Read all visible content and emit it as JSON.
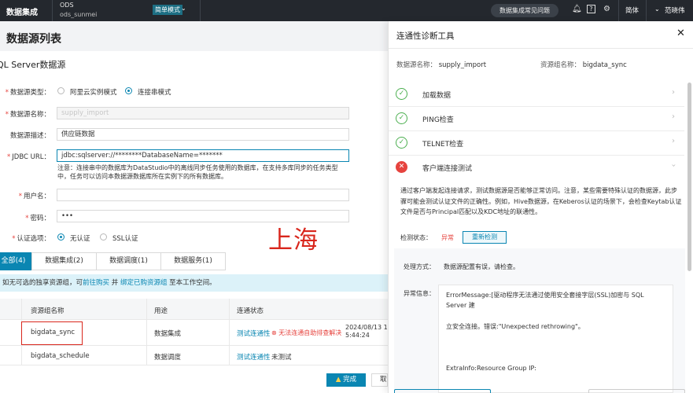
{
  "topbar": {
    "brand": "数据集成",
    "workspace_name": "ODS",
    "workspace_id": "ods_sunmei",
    "mode": "简单模式",
    "faq": "数据集成常见问题",
    "lang": "简体",
    "user": "范晓伟"
  },
  "page": {
    "title": "数据源列表",
    "section": "QL Server数据源"
  },
  "form": {
    "type_label": "数据源类型：",
    "type_opt1": "阿里云实例模式",
    "type_opt2": "连接串模式",
    "name_label": "数据源名称：",
    "name_value": "supply_import",
    "desc_label": "数据源描述：",
    "desc_value": "供应链数据",
    "jdbc_label": "JDBC URL：",
    "jdbc_value": "jdbc:sqlserver://********DatabaseName=*******",
    "note": "注意：连接串中的数据库为DataStudio中的离线同步任务使用的数据库，在支持多库同步的任务类型中，任务可以访问本数据源数据库所在实例下的所有数据库。",
    "user_label": "用户名：",
    "pwd_label": "密码：",
    "pwd_value": "•••",
    "auth_label": "认证选项：",
    "auth_opt1": "无认证",
    "auth_opt2": "SSL认证"
  },
  "overlay_text": "上海",
  "tabs": [
    "全部(4)",
    "数据集成(2)",
    "数据调度(1)",
    "数据服务(1)"
  ],
  "infobar": {
    "prefix": "如无可选的独享资源组，可",
    "link1": "前往购买",
    "mid": "并",
    "link2": "绑定已购资源组",
    "suffix": "至本工作空间。"
  },
  "table": {
    "headers": [
      "资源组名称",
      "用途",
      "连通状态"
    ],
    "rows": [
      {
        "name": "bigdata_sync",
        "use": "数据集成",
        "test": "测试连通性",
        "status": "⊗ 无法连通自助排查解决",
        "time": "2024/08/13 1\n5:44:24"
      },
      {
        "name": "bigdata_schedule",
        "use": "数据调度",
        "test": "测试连通性",
        "status": "未测试",
        "time": ""
      }
    ]
  },
  "buttons": {
    "done": "完成",
    "cut": "取"
  },
  "panel": {
    "title": "连通性诊断工具",
    "ds_label": "数据源名称：",
    "ds_value": "supply_import",
    "rg_label": "资源组名称：",
    "rg_value": "bigdata_sync",
    "checks": [
      "加载数据",
      "PING检查",
      "TELNET检查",
      "客户端连接测试"
    ],
    "desc": "通过客户端发起连接请求，测试数据源是否能够正常访问。注意，某些需要特殊认证的数据源，此步骤可能会测试认证文件的正确性。例如，Hive数据源，在Keberos认证的场景下，会检查Keytab认证文件是否与Principal匹配以及KDC地址的联通性。",
    "status_label": "检测状态：",
    "status_value": "异常",
    "recheck": "重新检测",
    "method_label": "处理方式：",
    "method_value": "数据源配置有误，请检查。",
    "exc_label": "异常信息：",
    "exc_line1": "ErrorMessage:[驱动程序无法通过使用安全套接字层(SSL)加密与 SQL Server 建",
    "exc_line2": "立安全连接。错误:\"Unexpected rethrowing\"。",
    "exc_line3": "ExtraInfo:Resource Group IP:"
  },
  "colors": {
    "accent": "#0a86b2",
    "error": "#e6433e",
    "success": "#4caf50",
    "topbar": "#24282e"
  }
}
